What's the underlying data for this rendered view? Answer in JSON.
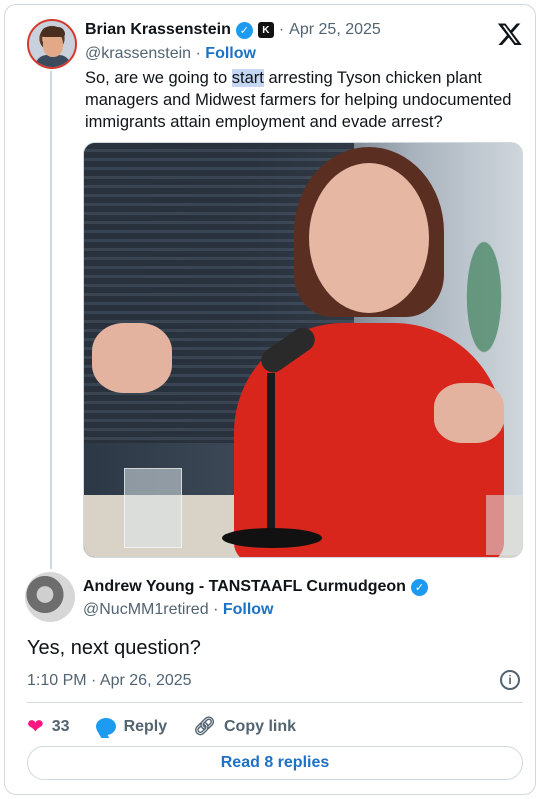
{
  "quoted_tweet": {
    "author_name": "Brian Krassenstein",
    "handle": "@krassenstein",
    "separator": "·",
    "date": "Apr 25, 2025",
    "follow_label": "Follow",
    "text_pre": "So, are we going to ",
    "text_highlight": "start",
    "text_post": " arresting Tyson chicken plant managers and Midwest farmers for helping undocumented immigrants attain employment and evade arrest?"
  },
  "reply_tweet": {
    "author_name": "Andrew Young - TANSTAAFL Curmudgeon",
    "handle": "@NucMM1retired",
    "separator": "·",
    "follow_label": "Follow",
    "text": "Yes, next question?",
    "timestamp": "1:10 PM · Apr 26, 2025"
  },
  "actions": {
    "like_count": "33",
    "reply_label": "Reply",
    "copy_link_label": "Copy link"
  },
  "read_replies_label": "Read 8 replies",
  "icons": {
    "verified": "verified-badge-icon",
    "x_logo": "x-logo-icon",
    "info": "info-icon",
    "like": "heart-icon",
    "reply": "reply-bubble-icon",
    "copy_link": "link-icon"
  },
  "colors": {
    "accent": "#1d9bf0",
    "link": "#1d72c4",
    "like": "#f91880",
    "muted": "#536471",
    "border": "#cfd9de"
  }
}
